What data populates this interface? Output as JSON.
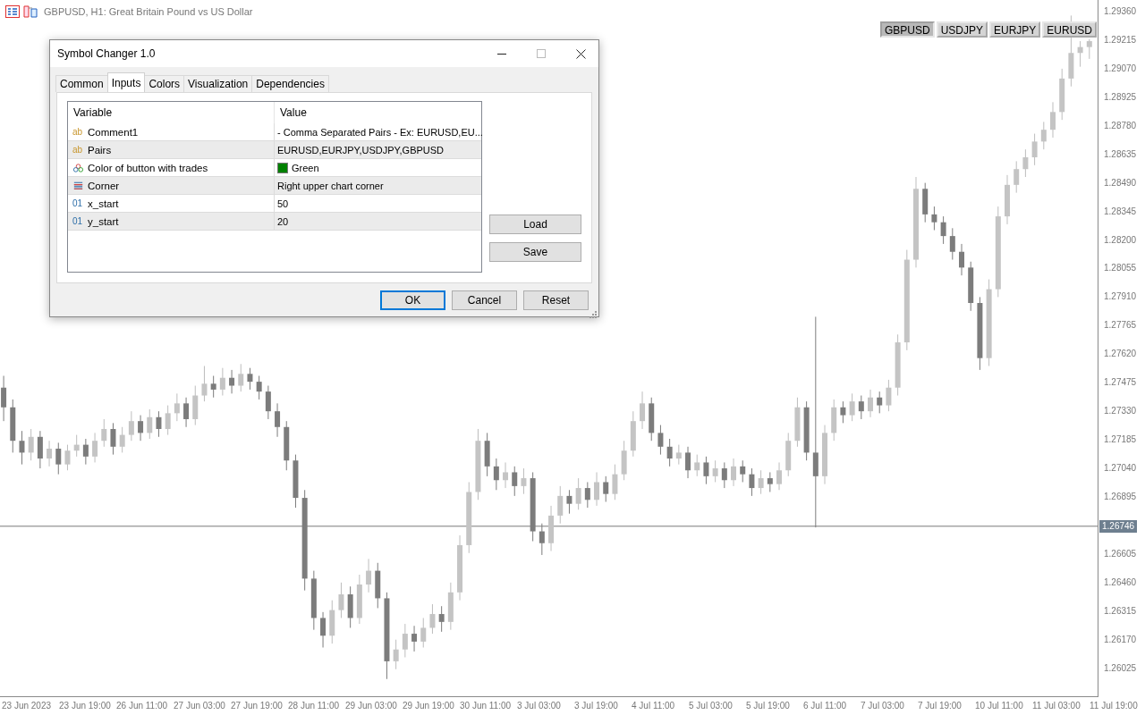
{
  "chart": {
    "title": "GBPUSD, H1:  Great Britain Pound vs US Dollar",
    "time_ticks": [
      "23 Jun 2023",
      "23 Jun 19:00",
      "26 Jun 11:00",
      "27 Jun 03:00",
      "27 Jun 19:00",
      "28 Jun 11:00",
      "29 Jun 03:00",
      "29 Jun 19:00",
      "30 Jun 11:00",
      "3 Jul 03:00",
      "3 Jul 19:00",
      "4 Jul 11:00",
      "5 Jul 03:00",
      "5 Jul 19:00",
      "6 Jul 11:00",
      "7 Jul 03:00",
      "7 Jul 19:00",
      "10 Jul 11:00",
      "11 Jul 03:00",
      "11 Jul 19:00"
    ],
    "chart_data": {
      "type": "candlestick",
      "ylim": [
        1.25878,
        1.29419
      ],
      "ref_lines": [
        {
          "axis": "y",
          "value": 1.26746,
          "label": "1.26746"
        }
      ],
      "yticks": [
        {
          "value": 1.2936,
          "label": "1.29360"
        },
        {
          "value": 1.29215,
          "label": "1.29215"
        },
        {
          "value": 1.2907,
          "label": "1.29070"
        },
        {
          "value": 1.28925,
          "label": "1.28925"
        },
        {
          "value": 1.2878,
          "label": "1.28780"
        },
        {
          "value": 1.28635,
          "label": "1.28635"
        },
        {
          "value": 1.2849,
          "label": "1.28490"
        },
        {
          "value": 1.28345,
          "label": "1.28345"
        },
        {
          "value": 1.282,
          "label": "1.28200"
        },
        {
          "value": 1.28055,
          "label": "1.28055"
        },
        {
          "value": 1.2791,
          "label": "1.27910"
        },
        {
          "value": 1.27765,
          "label": "1.27765"
        },
        {
          "value": 1.2762,
          "label": "1.27620"
        },
        {
          "value": 1.27475,
          "label": "1.27475"
        },
        {
          "value": 1.2733,
          "label": "1.27330"
        },
        {
          "value": 1.27185,
          "label": "1.27185"
        },
        {
          "value": 1.2704,
          "label": "1.27040"
        },
        {
          "value": 1.26895,
          "label": "1.26895"
        },
        {
          "value": 1.26605,
          "label": "1.26605"
        },
        {
          "value": 1.2646,
          "label": "1.26460"
        },
        {
          "value": 1.26315,
          "label": "1.26315"
        },
        {
          "value": 1.2617,
          "label": "1.26170"
        },
        {
          "value": 1.26025,
          "label": "1.26025"
        }
      ],
      "categories": [
        null,
        null,
        null,
        null,
        null,
        null,
        null,
        null,
        null,
        null,
        null,
        null,
        null,
        null,
        null,
        null,
        null,
        null,
        null,
        null,
        null,
        null,
        null,
        null,
        null,
        null,
        null,
        null,
        null,
        null,
        null,
        null,
        null,
        null,
        null,
        null,
        null,
        null,
        null,
        null,
        null,
        null,
        null,
        null,
        null,
        null,
        null,
        null,
        null,
        null,
        null,
        null,
        null,
        null,
        null,
        null,
        null,
        null,
        null,
        null,
        null,
        null,
        null,
        null,
        null,
        null,
        null,
        null,
        null,
        null,
        null,
        null,
        null,
        null,
        null,
        null,
        null,
        null,
        null,
        null,
        null,
        null,
        null,
        null,
        null,
        null,
        null,
        null,
        null,
        null,
        null,
        null,
        null,
        null,
        null,
        null,
        null,
        null,
        null,
        null,
        null,
        null,
        null,
        null,
        null,
        null,
        null,
        null,
        null,
        null,
        null,
        null,
        null,
        null,
        null,
        null,
        null,
        null,
        null,
        null
      ],
      "ohlc": [
        [
          1.2745,
          1.2751,
          1.2728,
          1.2735
        ],
        [
          1.2735,
          1.2739,
          1.2712,
          1.2718
        ],
        [
          1.2718,
          1.2723,
          1.2706,
          1.2712
        ],
        [
          1.2712,
          1.2724,
          1.2708,
          1.272
        ],
        [
          1.272,
          1.2723,
          1.2704,
          1.2709
        ],
        [
          1.2709,
          1.2718,
          1.2705,
          1.2714
        ],
        [
          1.2714,
          1.2717,
          1.2701,
          1.2706
        ],
        [
          1.2706,
          1.2716,
          1.2703,
          1.2713
        ],
        [
          1.2713,
          1.2721,
          1.271,
          1.2716
        ],
        [
          1.2716,
          1.2719,
          1.2706,
          1.271
        ],
        [
          1.271,
          1.2722,
          1.2707,
          1.2718
        ],
        [
          1.2718,
          1.2729,
          1.2715,
          1.2724
        ],
        [
          1.2724,
          1.2727,
          1.2711,
          1.2715
        ],
        [
          1.2715,
          1.2725,
          1.2712,
          1.2721
        ],
        [
          1.2721,
          1.2733,
          1.2718,
          1.2728
        ],
        [
          1.2728,
          1.2731,
          1.2718,
          1.2722
        ],
        [
          1.2722,
          1.2734,
          1.2719,
          1.273
        ],
        [
          1.273,
          1.2733,
          1.272,
          1.2724
        ],
        [
          1.2724,
          1.2736,
          1.2721,
          1.2732
        ],
        [
          1.2732,
          1.2742,
          1.2728,
          1.2737
        ],
        [
          1.2737,
          1.274,
          1.2725,
          1.2729
        ],
        [
          1.2729,
          1.2746,
          1.2726,
          1.2741
        ],
        [
          1.2741,
          1.2756,
          1.2738,
          1.2747
        ],
        [
          1.2747,
          1.2751,
          1.274,
          1.2744
        ],
        [
          1.2744,
          1.2755,
          1.2741,
          1.275
        ],
        [
          1.275,
          1.2754,
          1.2742,
          1.2746
        ],
        [
          1.2746,
          1.2757,
          1.2743,
          1.2752
        ],
        [
          1.2752,
          1.2755,
          1.2744,
          1.2748
        ],
        [
          1.2748,
          1.2751,
          1.2739,
          1.2743
        ],
        [
          1.2743,
          1.2746,
          1.2729,
          1.2733
        ],
        [
          1.2733,
          1.2737,
          1.272,
          1.2725
        ],
        [
          1.2725,
          1.2728,
          1.2703,
          1.2708
        ],
        [
          1.2708,
          1.2711,
          1.2684,
          1.2689
        ],
        [
          1.2689,
          1.2693,
          1.2642,
          1.2648
        ],
        [
          1.2648,
          1.2652,
          1.2622,
          1.2628
        ],
        [
          1.2628,
          1.2631,
          1.2613,
          1.2619
        ],
        [
          1.2619,
          1.2637,
          1.2615,
          1.2632
        ],
        [
          1.2632,
          1.2646,
          1.2628,
          1.264
        ],
        [
          1.264,
          1.2644,
          1.2623,
          1.2628
        ],
        [
          1.2628,
          1.265,
          1.2625,
          1.2645
        ],
        [
          1.2645,
          1.2658,
          1.2641,
          1.2652
        ],
        [
          1.2652,
          1.2656,
          1.2633,
          1.2638
        ],
        [
          1.2638,
          1.2641,
          1.2597,
          1.2606
        ],
        [
          1.2606,
          1.2617,
          1.2602,
          1.2612
        ],
        [
          1.2612,
          1.2625,
          1.2608,
          1.262
        ],
        [
          1.262,
          1.2624,
          1.2611,
          1.2616
        ],
        [
          1.2616,
          1.2628,
          1.2613,
          1.2623
        ],
        [
          1.2623,
          1.2635,
          1.262,
          1.263
        ],
        [
          1.263,
          1.2634,
          1.2621,
          1.2626
        ],
        [
          1.2626,
          1.2646,
          1.2622,
          1.2641
        ],
        [
          1.2641,
          1.267,
          1.2637,
          1.2665
        ],
        [
          1.2665,
          1.2697,
          1.2661,
          1.2692
        ],
        [
          1.2692,
          1.2724,
          1.2688,
          1.2718
        ],
        [
          1.2718,
          1.2722,
          1.27,
          1.2705
        ],
        [
          1.2705,
          1.2709,
          1.2693,
          1.2698
        ],
        [
          1.2698,
          1.2707,
          1.2694,
          1.2702
        ],
        [
          1.2702,
          1.2705,
          1.269,
          1.2695
        ],
        [
          1.2695,
          1.2704,
          1.2691,
          1.2699
        ],
        [
          1.2699,
          1.2702,
          1.2667,
          1.2672
        ],
        [
          1.2672,
          1.2676,
          1.266,
          1.2666
        ],
        [
          1.2666,
          1.2685,
          1.2662,
          1.268
        ],
        [
          1.268,
          1.2695,
          1.2676,
          1.269
        ],
        [
          1.269,
          1.2693,
          1.2681,
          1.2686
        ],
        [
          1.2686,
          1.2699,
          1.2683,
          1.2694
        ],
        [
          1.2694,
          1.2697,
          1.2684,
          1.2688
        ],
        [
          1.2688,
          1.2702,
          1.2685,
          1.2697
        ],
        [
          1.2697,
          1.27,
          1.2687,
          1.2691
        ],
        [
          1.2691,
          1.2706,
          1.2688,
          1.2701
        ],
        [
          1.2701,
          1.2718,
          1.2698,
          1.2713
        ],
        [
          1.2713,
          1.2733,
          1.271,
          1.2728
        ],
        [
          1.2728,
          1.2743,
          1.2724,
          1.2737
        ],
        [
          1.2737,
          1.274,
          1.2718,
          1.2722
        ],
        [
          1.2722,
          1.2726,
          1.2711,
          1.2715
        ],
        [
          1.2715,
          1.2719,
          1.2705,
          1.2709
        ],
        [
          1.2709,
          1.2716,
          1.2706,
          1.2712
        ],
        [
          1.2712,
          1.2715,
          1.2699,
          1.2703
        ],
        [
          1.2703,
          1.2711,
          1.27,
          1.2707
        ],
        [
          1.2707,
          1.271,
          1.2696,
          1.27
        ],
        [
          1.27,
          1.2708,
          1.2697,
          1.2704
        ],
        [
          1.2704,
          1.2707,
          1.2694,
          1.2698
        ],
        [
          1.2698,
          1.2709,
          1.2695,
          1.2705
        ],
        [
          1.2705,
          1.2708,
          1.2697,
          1.2701
        ],
        [
          1.2701,
          1.2704,
          1.269,
          1.2694
        ],
        [
          1.2694,
          1.2703,
          1.2691,
          1.2699
        ],
        [
          1.2699,
          1.2702,
          1.2692,
          1.2696
        ],
        [
          1.2696,
          1.2707,
          1.2693,
          1.2703
        ],
        [
          1.2703,
          1.2722,
          1.27,
          1.2718
        ],
        [
          1.2718,
          1.274,
          1.2715,
          1.2735
        ],
        [
          1.2735,
          1.2738,
          1.2708,
          1.2712
        ],
        [
          1.2712,
          1.2781,
          1.2674,
          1.27
        ],
        [
          1.27,
          1.2726,
          1.2696,
          1.2722
        ],
        [
          1.2722,
          1.2739,
          1.2718,
          1.2735
        ],
        [
          1.2735,
          1.2738,
          1.2727,
          1.2731
        ],
        [
          1.2731,
          1.2742,
          1.2728,
          1.2738
        ],
        [
          1.2738,
          1.2741,
          1.2729,
          1.2733
        ],
        [
          1.2733,
          1.2744,
          1.273,
          1.274
        ],
        [
          1.274,
          1.2743,
          1.2732,
          1.2736
        ],
        [
          1.2736,
          1.2749,
          1.2733,
          1.2745
        ],
        [
          1.2745,
          1.2772,
          1.2741,
          1.2768
        ],
        [
          1.2768,
          1.2815,
          1.2764,
          1.281
        ],
        [
          1.281,
          1.2852,
          1.2806,
          1.2846
        ],
        [
          1.2846,
          1.2849,
          1.2829,
          1.2833
        ],
        [
          1.2833,
          1.2837,
          1.2825,
          1.2829
        ],
        [
          1.2829,
          1.2832,
          1.2818,
          1.2822
        ],
        [
          1.2822,
          1.2826,
          1.281,
          1.2814
        ],
        [
          1.2814,
          1.2818,
          1.2802,
          1.2806
        ],
        [
          1.2806,
          1.2809,
          1.2784,
          1.2788
        ],
        [
          1.2788,
          1.2791,
          1.2754,
          1.276
        ],
        [
          1.276,
          1.28,
          1.2756,
          1.2795
        ],
        [
          1.2795,
          1.2837,
          1.2791,
          1.2832
        ],
        [
          1.2832,
          1.2853,
          1.2828,
          1.2848
        ],
        [
          1.2848,
          1.286,
          1.2844,
          1.2856
        ],
        [
          1.2856,
          1.2866,
          1.2852,
          1.2862
        ],
        [
          1.2862,
          1.2874,
          1.2858,
          1.287
        ],
        [
          1.287,
          1.288,
          1.2866,
          1.2876
        ],
        [
          1.2876,
          1.289,
          1.2872,
          1.2885
        ],
        [
          1.2885,
          1.2907,
          1.2881,
          1.2902
        ],
        [
          1.2902,
          1.2934,
          1.2898,
          1.2915
        ],
        [
          1.2915,
          1.2921,
          1.2908,
          1.2918
        ],
        [
          1.2918,
          1.2922,
          1.2912,
          1.2921
        ]
      ]
    }
  },
  "symbol_buttons": [
    {
      "label": "GBPUSD",
      "selected": true
    },
    {
      "label": "USDJPY",
      "selected": false
    },
    {
      "label": "EURJPY",
      "selected": false
    },
    {
      "label": "EURUSD",
      "selected": false
    }
  ],
  "dialog": {
    "title": "Symbol Changer 1.0",
    "tabs": [
      {
        "label": "Common",
        "selected": false
      },
      {
        "label": "Inputs",
        "selected": true
      },
      {
        "label": "Colors",
        "selected": false
      },
      {
        "label": "Visualization",
        "selected": false
      },
      {
        "label": "Dependencies",
        "selected": false
      }
    ],
    "table": {
      "columns": [
        "Variable",
        "Value"
      ],
      "rows": [
        {
          "kind": "string",
          "type_label": "ab",
          "variable": "Comment1",
          "value": "- Comma Separated Pairs - Ex: EURUSD,EU..."
        },
        {
          "kind": "string",
          "type_label": "ab",
          "variable": "Pairs",
          "value": "EURUSD,EURJPY,USDJPY,GBPUSD"
        },
        {
          "kind": "color",
          "variable": "Color of button with trades",
          "value": "Green",
          "color": "#008000"
        },
        {
          "kind": "enum",
          "variable": "Corner",
          "value": "Right upper chart corner"
        },
        {
          "kind": "int",
          "type_label": "01",
          "variable": "x_start",
          "value": "50"
        },
        {
          "kind": "int",
          "type_label": "01",
          "variable": "y_start",
          "value": "20"
        }
      ]
    },
    "side_buttons": [
      "Load",
      "Save"
    ],
    "buttons": [
      {
        "label": "OK",
        "default": true
      },
      {
        "label": "Cancel",
        "default": false
      },
      {
        "label": "Reset",
        "default": false
      }
    ]
  }
}
